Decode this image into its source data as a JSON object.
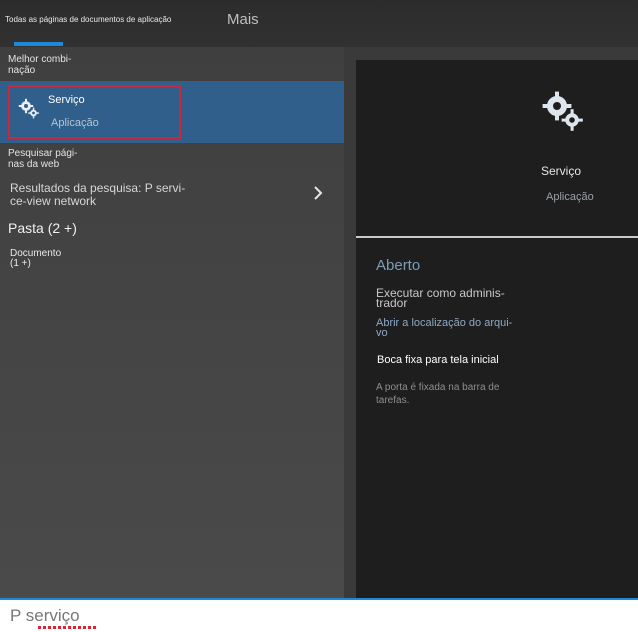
{
  "tabs": {
    "all_label": "Todas as páginas de documentos de aplicação",
    "more_label": "Mais"
  },
  "left": {
    "best_match_label": "Melhor combi-\nnação",
    "best_match": {
      "title": "Serviço",
      "subtitle": "Aplicação",
      "icon": "gear-icon"
    },
    "web_label": "Pesquisar pági-\nnas da web",
    "web_result": "Resultados da pesquisa: P servi-\nce-view network",
    "folder_label": "Pasta (2 +)",
    "document_label": "Documento\n(1 +)"
  },
  "preview": {
    "icon": "gear-icon",
    "title": "Serviço",
    "subtitle": "Aplicação",
    "open_label": "Aberto",
    "actions": [
      "Executar como adminis-\ntrador",
      "Abrir a localização do arqui-\nvo",
      "Boca fixa para tela inicial"
    ],
    "pin_note": "A porta é fixada na barra de\ntarefas."
  },
  "search": {
    "value": "P serviço"
  },
  "colors": {
    "accent": "#1e88d9",
    "selection": "#2f5f8a",
    "highlight_border": "#c8283b"
  }
}
